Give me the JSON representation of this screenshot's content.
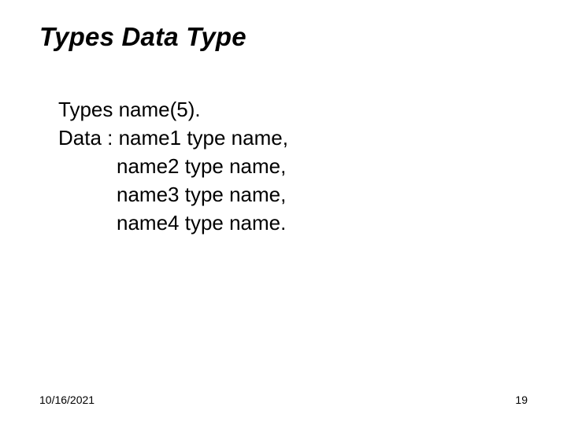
{
  "title": "Types Data Type",
  "body": {
    "line1": "Types name(5).",
    "line2": "Data : name1 type name,",
    "line3_indent": "name2 type name,",
    "line4_indent": "name3 type name,",
    "line5_indent": "name4 type name."
  },
  "footer": {
    "date": "10/16/2021",
    "page": "19"
  }
}
